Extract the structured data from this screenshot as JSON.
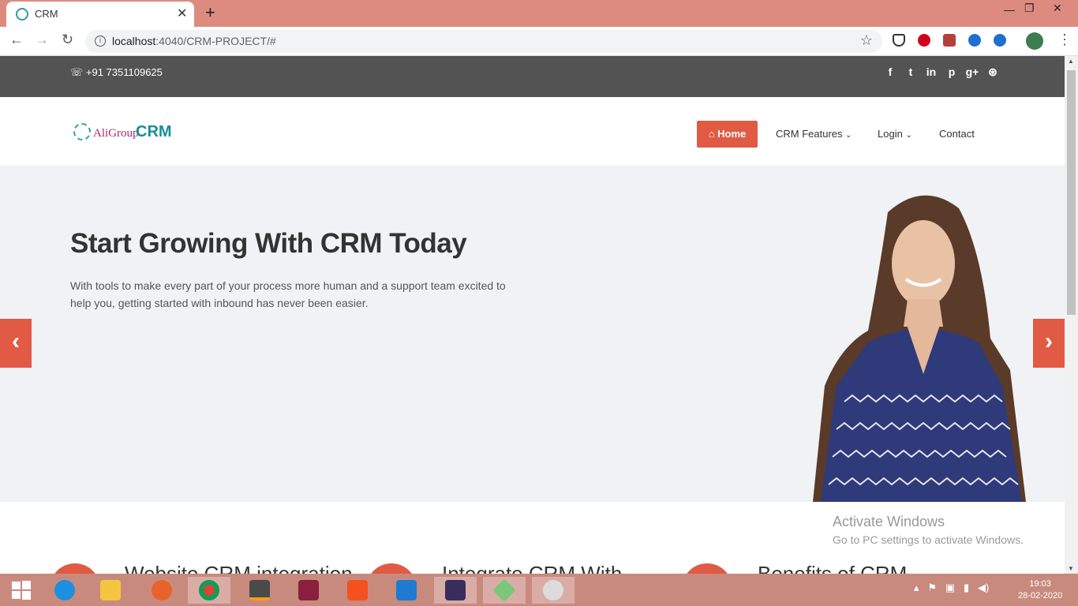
{
  "browser": {
    "tab_title": "CRM",
    "tab_close": "✕",
    "new_tab": "+",
    "url_host": "localhost",
    "url_rest": ":4040/CRM-PROJECT/#",
    "window_min": "—",
    "window_restore": "❐",
    "window_close": "✕",
    "back": "←",
    "forward": "→",
    "reload": "↻",
    "star": "☆",
    "menu": "⋮"
  },
  "topbar": {
    "phone": "+91 7351109625",
    "phone_icon": "☏",
    "social": [
      "f",
      "t",
      "in",
      "p",
      "g+",
      "⊛"
    ]
  },
  "header": {
    "logo_text1": "AliGroup",
    "logo_text2": "CRM",
    "home_icon": "⌂",
    "nav_home": "Home",
    "nav_features": "CRM Features",
    "nav_login": "Login",
    "nav_contact": "Contact",
    "chevron": "⌄"
  },
  "hero": {
    "title": "Start Growing With CRM Today",
    "text": "With tools to make every part of your process more human and a support team excited to help you, getting started with inbound has never been easier.",
    "prev": "‹",
    "next": "›"
  },
  "features": {
    "items": [
      "Website CRM integration",
      "Integrate CRM With",
      "Benefits of CRM"
    ]
  },
  "watermark": {
    "line1": "Activate Windows",
    "line2": "Go to PC settings to activate Windows."
  },
  "taskbar": {
    "time": "19:03",
    "date": "28-02-2020"
  },
  "colors": {
    "accent": "#e05a44",
    "topbar": "#535353",
    "hero_bg": "#f0f2f5",
    "tab_bar": "#de8b7f"
  }
}
